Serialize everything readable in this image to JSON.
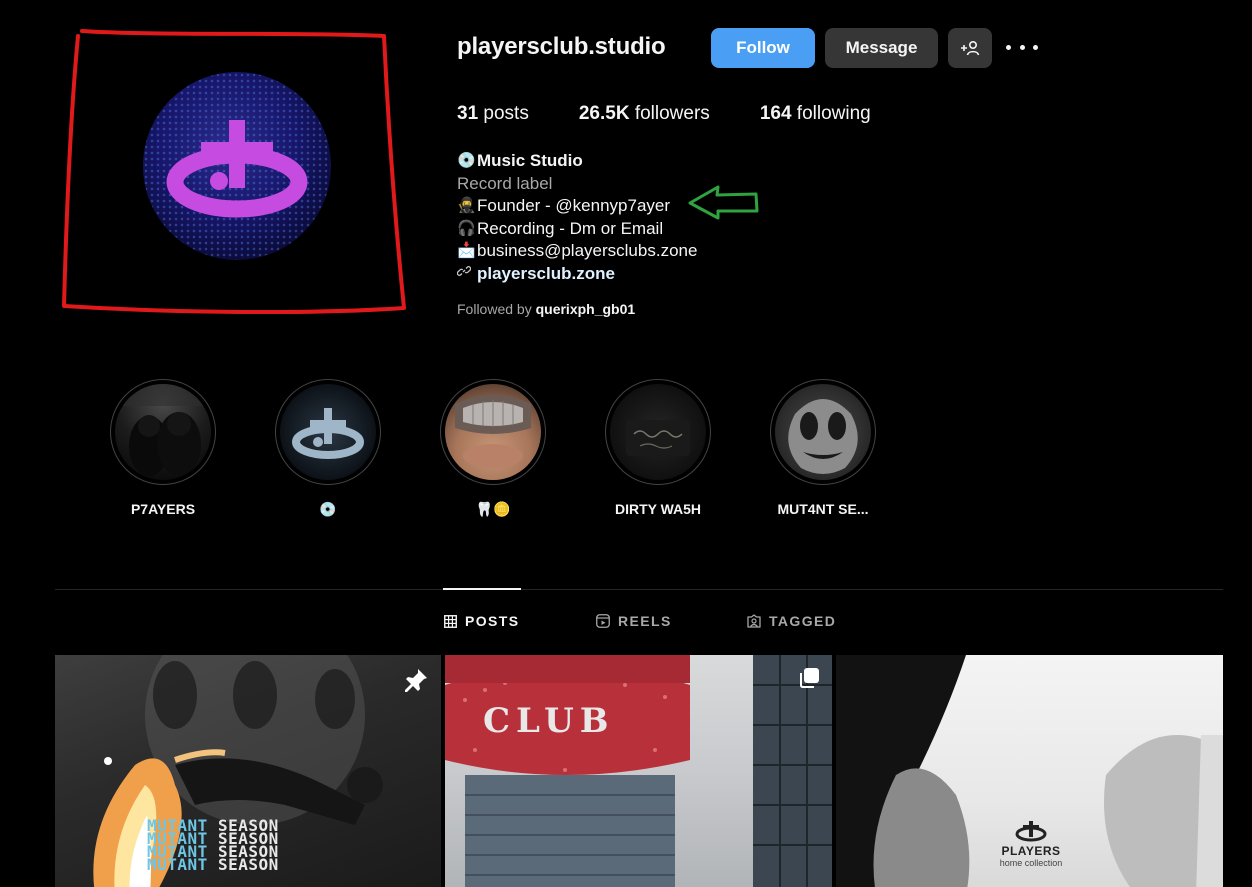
{
  "profile": {
    "username": "playersclub.studio",
    "follow_label": "Follow",
    "message_label": "Message",
    "add_user_label": "+⚇"
  },
  "stats": {
    "posts_count": "31",
    "posts_label": "posts",
    "followers_count": "26.5K",
    "followers_label": "followers",
    "following_count": "164",
    "following_label": "following"
  },
  "bio": {
    "name_emoji": "💿",
    "name": "Music Studio",
    "category": "Record label",
    "line1_emoji": "🥷",
    "line1": "Founder - @kennyp7ayer",
    "line2_emoji": "🎧",
    "line2": "Recording - Dm or Email",
    "line3_emoji": "📩",
    "line3": "business@playersclubs.zone",
    "link": "playersclub.zone"
  },
  "followed_by": {
    "prefix": "Followed by",
    "user": "querixph_gb01"
  },
  "highlights": [
    {
      "label": "P7AYERS"
    },
    {
      "label": "💿"
    },
    {
      "label": "🦷🪙"
    },
    {
      "label": "DIRTY WA5H"
    },
    {
      "label": "MUT4NT SE..."
    }
  ],
  "tabs": [
    {
      "label": "POSTS",
      "active": true
    },
    {
      "label": "REELS",
      "active": false
    },
    {
      "label": "TAGGED",
      "active": false
    }
  ],
  "posts": [
    {
      "overlay_text": [
        "MUTANT",
        "SEASON",
        "MUTANT",
        "SEASON",
        "MUTANT",
        "SEASON",
        "MUTANT",
        "SEASON"
      ],
      "pinned": true
    },
    {
      "sign_text": "CLUB",
      "multi": true
    },
    {
      "logo_word": "PLAYERS",
      "logo_sub": "home collection"
    }
  ],
  "colors": {
    "background": "#000000",
    "follow_button": "#4a9ff5",
    "secondary_button": "#363636",
    "annotation_red": "#e0191b",
    "annotation_green": "#2fa33f",
    "logo_purple": "#c64be0"
  },
  "icons": {
    "pin": "pin-icon",
    "multi": "multiple-posts-icon",
    "link": "link-icon",
    "grid": "grid-icon",
    "reels": "reels-icon",
    "tagged": "tagged-icon"
  }
}
